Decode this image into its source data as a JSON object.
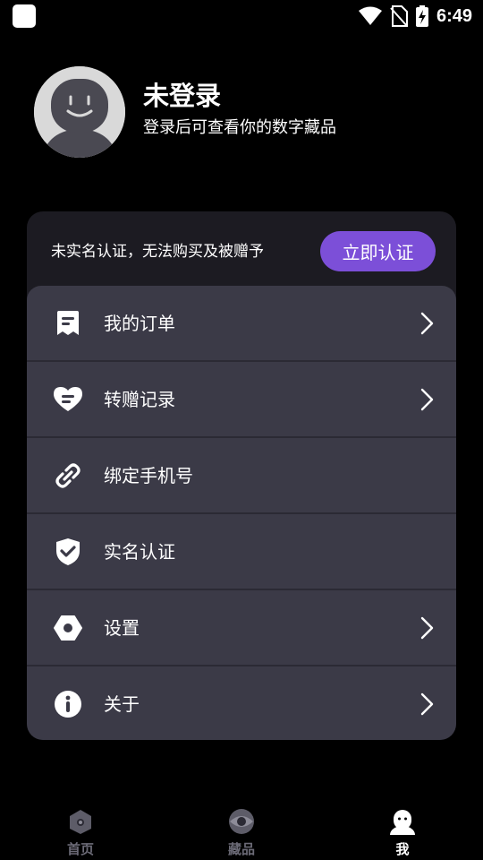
{
  "status_bar": {
    "time": "6:49",
    "icons": [
      "app-icon",
      "wifi-icon",
      "no-sim-icon",
      "battery-charging-icon"
    ]
  },
  "profile": {
    "name": "未登录",
    "subtitle": "登录后可查看你的数字藏品",
    "avatar_icon": "default-avatar-icon"
  },
  "verify": {
    "text": "未实名认证，无法购买及被赠予",
    "button_label": "立即认证"
  },
  "menu": {
    "items": [
      {
        "label": "我的订单",
        "icon": "receipt-icon",
        "has_chevron": true
      },
      {
        "label": "转赠记录",
        "icon": "heart-gift-icon",
        "has_chevron": true
      },
      {
        "label": "绑定手机号",
        "icon": "link-icon",
        "has_chevron": false
      },
      {
        "label": "实名认证",
        "icon": "shield-check-icon",
        "has_chevron": false
      },
      {
        "label": "设置",
        "icon": "hexagon-settings-icon",
        "has_chevron": true
      },
      {
        "label": "关于",
        "icon": "info-icon",
        "has_chevron": true
      }
    ]
  },
  "bottom_nav": {
    "items": [
      {
        "label": "首页",
        "icon": "home-icon",
        "active": false
      },
      {
        "label": "藏品",
        "icon": "collection-icon",
        "active": false
      },
      {
        "label": "我",
        "icon": "profile-icon",
        "active": true
      }
    ]
  },
  "colors": {
    "background": "#000000",
    "card": "#1c1b22",
    "menu_bg": "#3b3a47",
    "accent": "#7c4fd8",
    "nav_inactive": "#6b6a76"
  }
}
